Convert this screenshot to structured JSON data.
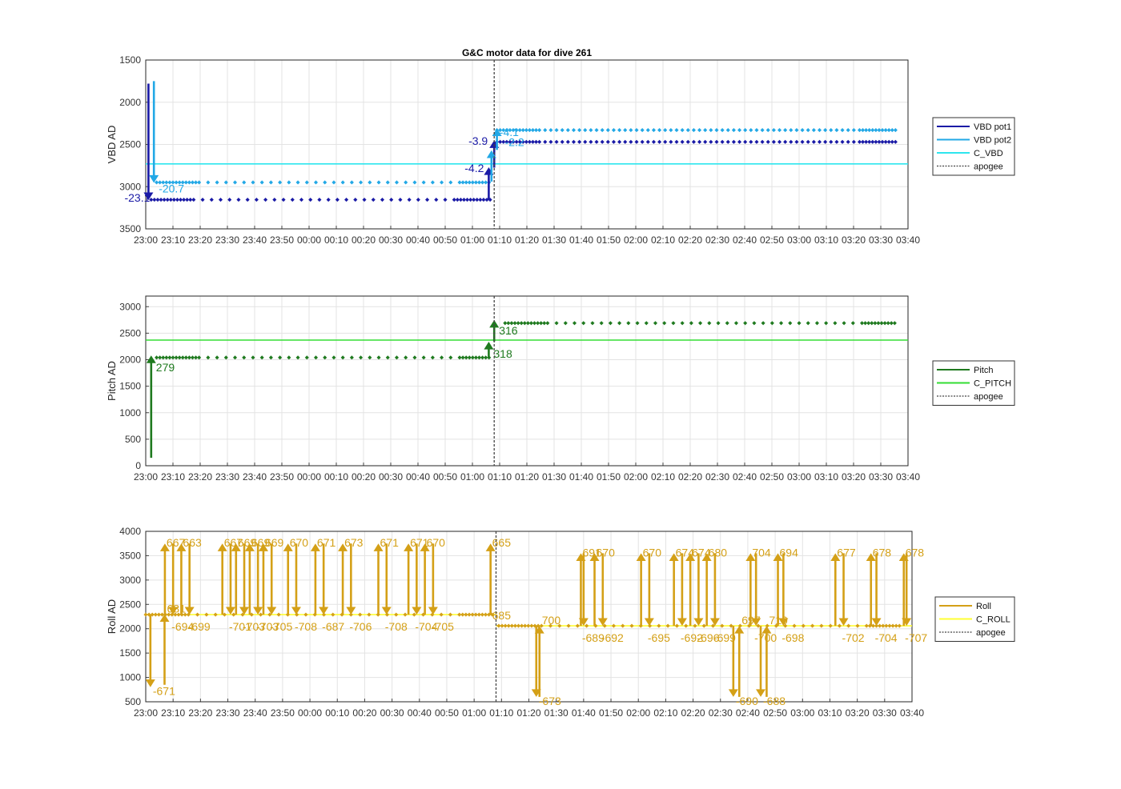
{
  "title": "G&C motor data for dive 261",
  "time_ticks": [
    "23:00",
    "23:10",
    "23:20",
    "23:30",
    "23:40",
    "23:50",
    "00:00",
    "00:10",
    "00:20",
    "00:30",
    "00:40",
    "00:50",
    "01:00",
    "01:10",
    "01:20",
    "01:30",
    "01:40",
    "01:50",
    "02:00",
    "02:10",
    "02:20",
    "02:30",
    "02:40",
    "02:50",
    "03:00",
    "03:10",
    "03:20",
    "03:30",
    "03:40"
  ],
  "chart_data": [
    {
      "type": "scatter",
      "name": "vbd",
      "ylabel": "VBD AD",
      "xlim": [
        "23:00",
        "03:40"
      ],
      "ylim": [
        1500,
        3500
      ],
      "y_reversed": true,
      "yticks": [
        1500,
        2000,
        2500,
        3000,
        3500
      ],
      "grid": true,
      "legend_placement": "right",
      "apogee": "01:08",
      "legend": [
        {
          "label": "VBD pot1",
          "color": "#1a1aa6",
          "style": "solid"
        },
        {
          "label": "VBD pot2",
          "color": "#22a8e6",
          "style": "solid"
        },
        {
          "label": "C_VBD",
          "color": "#2ee6ee",
          "style": "solid"
        },
        {
          "label": "apogee",
          "color": "#444444",
          "style": "dashed"
        }
      ],
      "hlines": [
        {
          "name": "C_VBD",
          "y": 2730,
          "color": "#2ee6ee"
        }
      ],
      "series": [
        {
          "name": "VBD pot1",
          "color": "#1a1aa6",
          "segments": [
            {
              "x0": "23:02",
              "x1": "01:07",
              "y": 3155
            },
            {
              "x0": "01:09",
              "x1": "03:36",
              "y": 2470
            }
          ]
        },
        {
          "name": "VBD pot2",
          "color": "#22a8e6",
          "segments": [
            {
              "x0": "23:04",
              "x1": "01:07",
              "y": 2950
            },
            {
              "x0": "01:09",
              "x1": "03:36",
              "y": 2330
            }
          ]
        }
      ],
      "moves": [
        {
          "x": "23:01",
          "y0": 1780,
          "y1": 3160,
          "color": "#1a1aa6",
          "label": "-23.1"
        },
        {
          "x": "23:03",
          "y0": 1750,
          "y1": 2955,
          "color": "#22a8e6",
          "label": "-20.7"
        },
        {
          "x": "01:06",
          "y0": 3150,
          "y1": 2770,
          "color": "#1a1aa6",
          "label": "-4.2"
        },
        {
          "x": "01:08",
          "y0": 2775,
          "y1": 2450,
          "color": "#1a1aa6",
          "label": "-3.9"
        },
        {
          "x": "01:07",
          "y0": 2940,
          "y1": 2570,
          "color": "#22a8e6",
          "label": "-4.1"
        },
        {
          "x": "01:09",
          "y0": 2565,
          "y1": 2310,
          "color": "#22a8e6",
          "label": "-2.2"
        }
      ]
    },
    {
      "type": "scatter",
      "name": "pitch",
      "ylabel": "Pitch AD",
      "xlim": [
        "23:00",
        "03:40"
      ],
      "ylim": [
        0,
        3200
      ],
      "y_reversed": false,
      "yticks": [
        0,
        500,
        1000,
        1500,
        2000,
        2500,
        3000
      ],
      "grid": true,
      "legend_placement": "right",
      "apogee": "01:08",
      "legend": [
        {
          "label": "Pitch",
          "color": "#1f7a1f",
          "style": "solid"
        },
        {
          "label": "C_PITCH",
          "color": "#33dd33",
          "style": "solid"
        },
        {
          "label": "apogee",
          "color": "#444444",
          "style": "dashed"
        }
      ],
      "hlines": [
        {
          "name": "C_PITCH",
          "y": 2370,
          "color": "#33dd33"
        }
      ],
      "series": [
        {
          "name": "Pitch",
          "color": "#1f7a1f",
          "segments": [
            {
              "x0": "23:04",
              "x1": "01:07",
              "y": 2040
            },
            {
              "x0": "01:12",
              "x1": "03:36",
              "y": 2690
            }
          ]
        }
      ],
      "moves": [
        {
          "x": "23:02",
          "y0": 150,
          "y1": 2080,
          "color": "#1f7a1f",
          "label": "279"
        },
        {
          "x": "01:06",
          "y0": 2030,
          "y1": 2340,
          "color": "#1f7a1f",
          "label": "318"
        },
        {
          "x": "01:08",
          "y0": 2345,
          "y1": 2750,
          "color": "#1f7a1f",
          "label": "316"
        }
      ]
    },
    {
      "type": "scatter",
      "name": "roll",
      "ylabel": "Roll AD",
      "xlim": [
        "23:00",
        "03:40"
      ],
      "ylim": [
        500,
        4000
      ],
      "y_reversed": false,
      "yticks": [
        500,
        1000,
        1500,
        2000,
        2500,
        3000,
        3500,
        4000
      ],
      "grid": true,
      "legend_placement": "right",
      "apogee": "01:08",
      "legend": [
        {
          "label": "Roll",
          "color": "#d4a017",
          "style": "solid"
        },
        {
          "label": "C_ROLL",
          "color": "#ffff33",
          "style": "solid"
        },
        {
          "label": "apogee",
          "color": "#444444",
          "style": "dashed"
        }
      ],
      "hlines": [
        {
          "name": "C_ROLL",
          "x0": "23:00",
          "x1": "01:08",
          "y": 2290,
          "color": "#ffff33"
        },
        {
          "name": "C_ROLL",
          "x0": "01:08",
          "x1": "03:40",
          "y": 2060,
          "color": "#ffff33"
        }
      ],
      "series": [
        {
          "name": "Roll",
          "color": "#d4a017",
          "segments": [
            {
              "x0": "23:00",
              "x1": "01:07",
              "y": 2290
            },
            {
              "x0": "01:09",
              "x1": "03:36",
              "y": 2060
            }
          ]
        }
      ],
      "spikes": [
        {
          "x": "23:07",
          "x2": "23:10",
          "top": 3750,
          "up": "667",
          "down": "-694"
        },
        {
          "x": "23:13",
          "x2": "23:16",
          "top": 3750,
          "up": "663",
          "down": "-699"
        },
        {
          "x": "23:28",
          "x2": "23:31",
          "top": 3750,
          "up": "667",
          "down": "-701"
        },
        {
          "x": "23:33",
          "x2": "23:36",
          "top": 3750,
          "up": "669",
          "down": "-703"
        },
        {
          "x": "23:38",
          "x2": "23:41",
          "top": 3750,
          "up": "669",
          "down": "-703"
        },
        {
          "x": "23:43",
          "x2": "23:46",
          "top": 3750,
          "up": "669",
          "down": "-705"
        },
        {
          "x": "23:52",
          "x2": "23:55",
          "top": 3750,
          "up": "670",
          "down": "-708"
        },
        {
          "x": "00:02",
          "x2": "00:05",
          "top": 3750,
          "up": "671",
          "down": "-687"
        },
        {
          "x": "00:12",
          "x2": "00:15",
          "top": 3750,
          "up": "673",
          "down": "-706"
        },
        {
          "x": "00:25",
          "x2": "00:28",
          "top": 3750,
          "up": "671",
          "down": "-708"
        },
        {
          "x": "00:36",
          "x2": "00:39",
          "top": 3750,
          "up": "671",
          "down": "-704"
        },
        {
          "x": "00:42",
          "x2": "00:45",
          "top": 3750,
          "up": "670",
          "down": "-705"
        },
        {
          "x": "01:06",
          "x2": "01:07",
          "top": 3750,
          "up": "665",
          "down": ""
        },
        {
          "x": "01:39",
          "x2": "01:40",
          "top": 3550,
          "up": "691",
          "down": "-689"
        },
        {
          "x": "01:44",
          "x2": "01:47",
          "top": 3550,
          "up": "670",
          "down": "-692"
        },
        {
          "x": "02:01",
          "x2": "02:04",
          "top": 3550,
          "up": "670",
          "down": "-695"
        },
        {
          "x": "02:13",
          "x2": "02:16",
          "top": 3550,
          "up": "674",
          "down": "-692"
        },
        {
          "x": "02:19",
          "x2": "02:22",
          "top": 3550,
          "up": "674",
          "down": "-696"
        },
        {
          "x": "02:25",
          "x2": "02:28",
          "top": 3550,
          "up": "680",
          "down": "-699"
        },
        {
          "x": "02:41",
          "x2": "02:43",
          "top": 3550,
          "up": "704",
          "down": "-700"
        },
        {
          "x": "02:51",
          "x2": "02:53",
          "top": 3550,
          "up": "694",
          "down": "-698"
        },
        {
          "x": "03:12",
          "x2": "03:15",
          "top": 3550,
          "up": "677",
          "down": "-702"
        },
        {
          "x": "03:25",
          "x2": "03:27",
          "top": 3550,
          "up": "678",
          "down": "-704"
        },
        {
          "x": "03:37",
          "x2": "03:38",
          "top": 3550,
          "up": "678",
          "down": "-707"
        }
      ],
      "low_moves": [
        {
          "x": "23:02",
          "from": 2280,
          "to": 800,
          "label": "-671",
          "dir": "down"
        },
        {
          "x": "23:06",
          "from": 850,
          "to": 2300,
          "label": "681",
          "dir": "up"
        },
        {
          "x": "01:23",
          "from": 2060,
          "to": 600,
          "label": "-673",
          "dir": "down"
        },
        {
          "x": "01:23",
          "from": 600,
          "to": 2060,
          "label": "700",
          "dir": "up"
        },
        {
          "x": "02:35",
          "from": 2060,
          "to": 600,
          "label": "-690",
          "dir": "down"
        },
        {
          "x": "02:36",
          "from": 600,
          "to": 2060,
          "label": "697",
          "dir": "up"
        },
        {
          "x": "02:45",
          "from": 2060,
          "to": 600,
          "label": "-688",
          "dir": "down"
        },
        {
          "x": "02:46",
          "from": 600,
          "to": 2060,
          "label": "710",
          "dir": "up"
        }
      ]
    }
  ]
}
